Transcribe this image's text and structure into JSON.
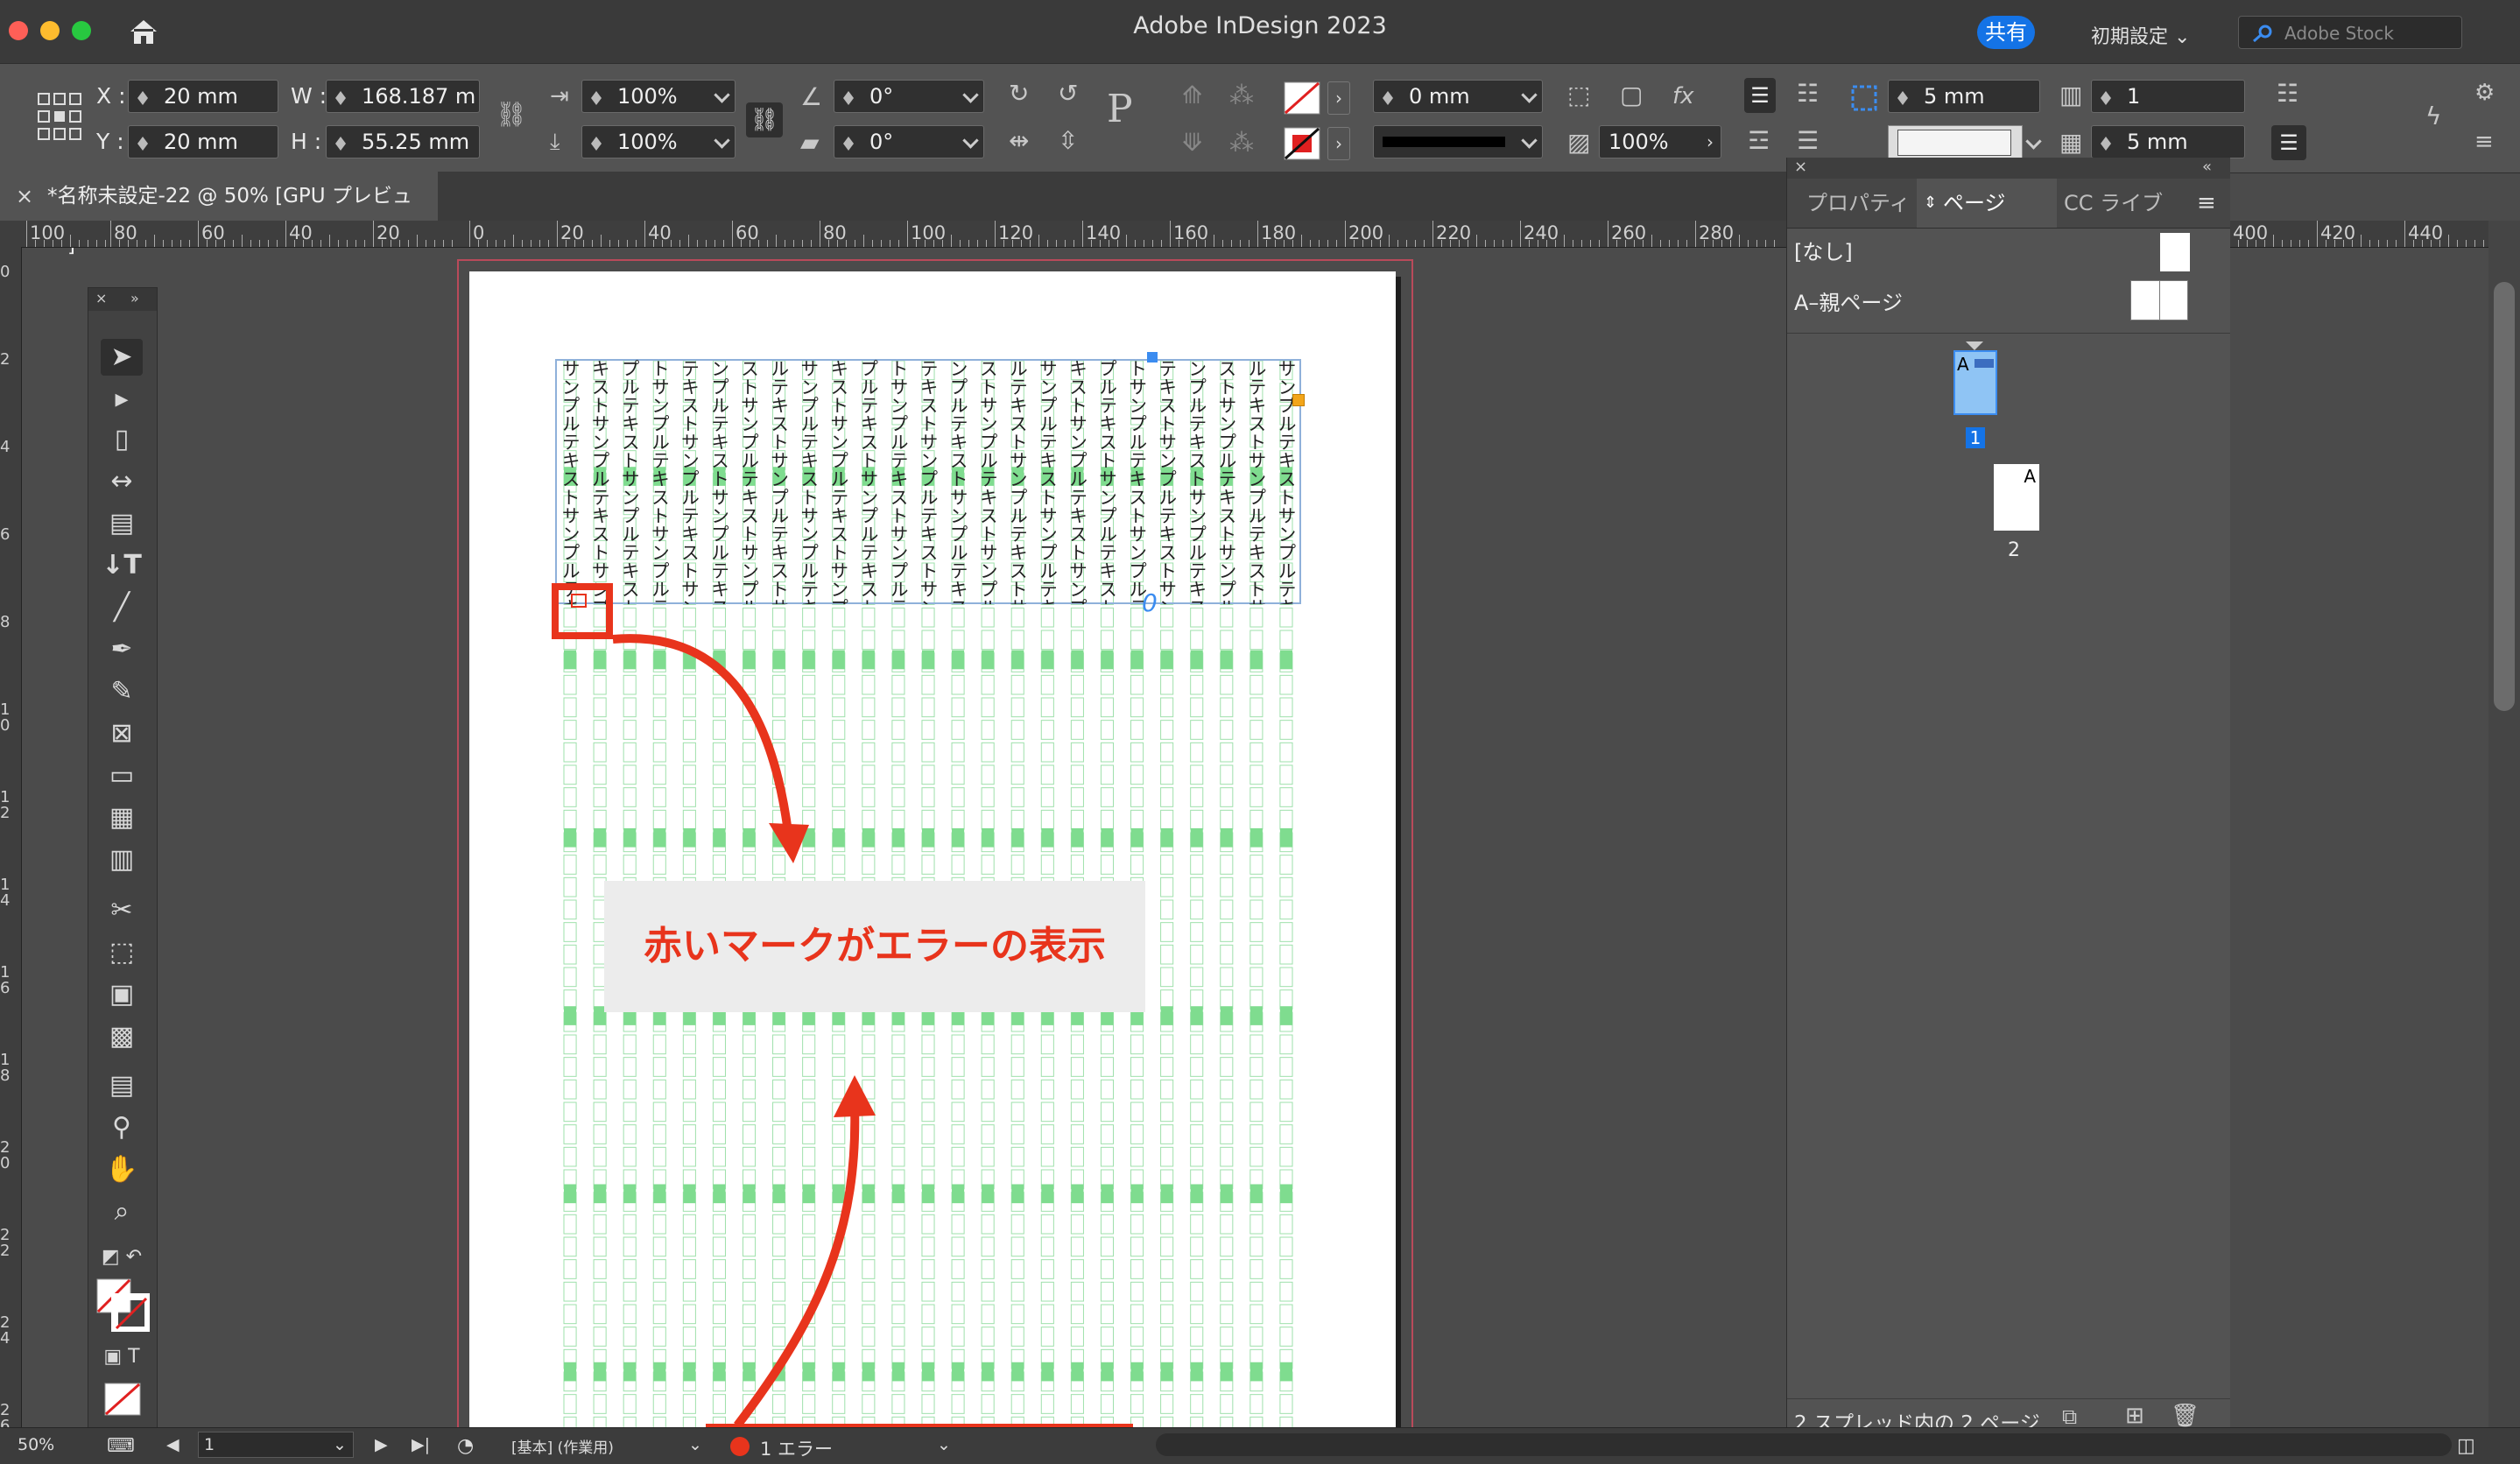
{
  "window": {
    "title": "Adobe InDesign 2023",
    "share": "共有",
    "workspace": "初期設定",
    "stock_placeholder": "Adobe Stock"
  },
  "control": {
    "x_label": "X :",
    "x": "20 mm",
    "y_label": "Y :",
    "y": "20 mm",
    "w_label": "W :",
    "w": "168.187 m",
    "h_label": "H :",
    "h": "55.25 mm",
    "scale_x": "100%",
    "scale_y": "100%",
    "rotate": "0°",
    "shear": "0°",
    "stroke_weight": "0 mm",
    "opacity": "100%",
    "gutter": "5 mm",
    "columns": "1",
    "col_gutter": "5 mm"
  },
  "tab": {
    "title": "*名称未設定-22 @ 50% [GPU プレビュー]",
    "close": "×"
  },
  "ruler": {
    "h_ticks": [
      "100",
      "80",
      "60",
      "40",
      "20",
      "0",
      "20",
      "40",
      "60",
      "80",
      "100",
      "120",
      "140",
      "160",
      "180",
      "200",
      "220",
      "240",
      "260",
      "280",
      "400",
      "420",
      "440"
    ],
    "v_ticks": [
      "0",
      "2",
      "4",
      "6",
      "8",
      "1 0",
      "1 2",
      "1 4",
      "1 6",
      "1 8",
      "2 0",
      "2 2",
      "2 4",
      "2 6"
    ]
  },
  "annotation": {
    "text": "赤いマークがエラーの表示"
  },
  "panel": {
    "tabs": [
      "プロパティ",
      "ページ",
      "CC ライブ"
    ],
    "masters": [
      {
        "name": "[なし]"
      },
      {
        "name": "A–親ページ"
      }
    ],
    "pages": [
      {
        "num": "1",
        "master": "A"
      },
      {
        "num": "2",
        "master": "A"
      }
    ],
    "footer": "2 スプレッド内の 2 ページ"
  },
  "status": {
    "zoom": "50%",
    "page": "1",
    "style": "[基本] (作業用)",
    "errors": "1 エラー"
  },
  "vertical_text": {
    "text": "サンプルテキスト"
  },
  "colors": {
    "accent": "#1473e6",
    "error_red": "#e8341c",
    "grid_green": "#7fdc8f"
  }
}
